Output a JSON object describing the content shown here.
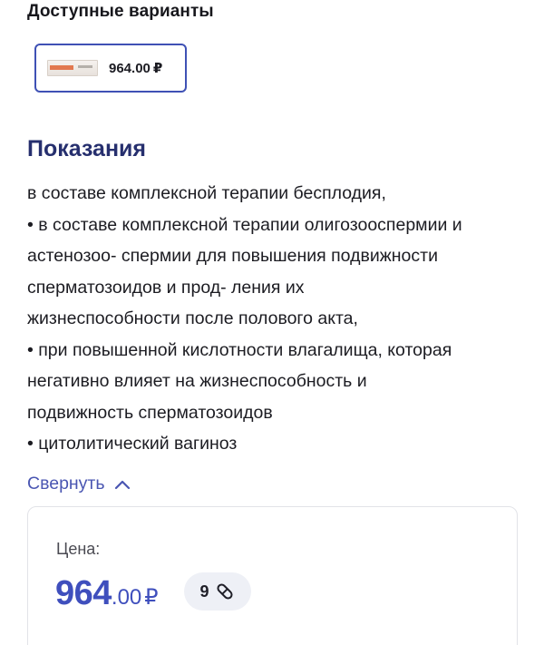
{
  "variants": {
    "title": "Доступные варианты",
    "items": [
      {
        "price": "964.00",
        "currency": "₽"
      }
    ]
  },
  "indications": {
    "title": "Показания",
    "lines": [
      "в составе комплексной терапии бесплодия,",
      "• в составе комплексной терапии олигозооспермии и",
      "астенозоо- спермии для повышения подвижности",
      "сперматозоидов и прод- ления их",
      "жизнеспособности после полового акта,",
      "• при повышенной кислотности влагалища, которая",
      "негативно влияет на жизнеспособность и",
      "подвижность сперматозоидов",
      "• цитолитический вагиноз"
    ],
    "collapse_label": "Свернуть"
  },
  "price": {
    "label": "Цена:",
    "integer": "964",
    "decimal": ".00",
    "currency": "₽",
    "bonus_count": "9",
    "bonus_icon": "pill-icon"
  },
  "colors": {
    "accent": "#3f4fbd",
    "heading": "#262f6e",
    "card_border": "#3f51b5",
    "pill_bg": "#eef0f6"
  }
}
